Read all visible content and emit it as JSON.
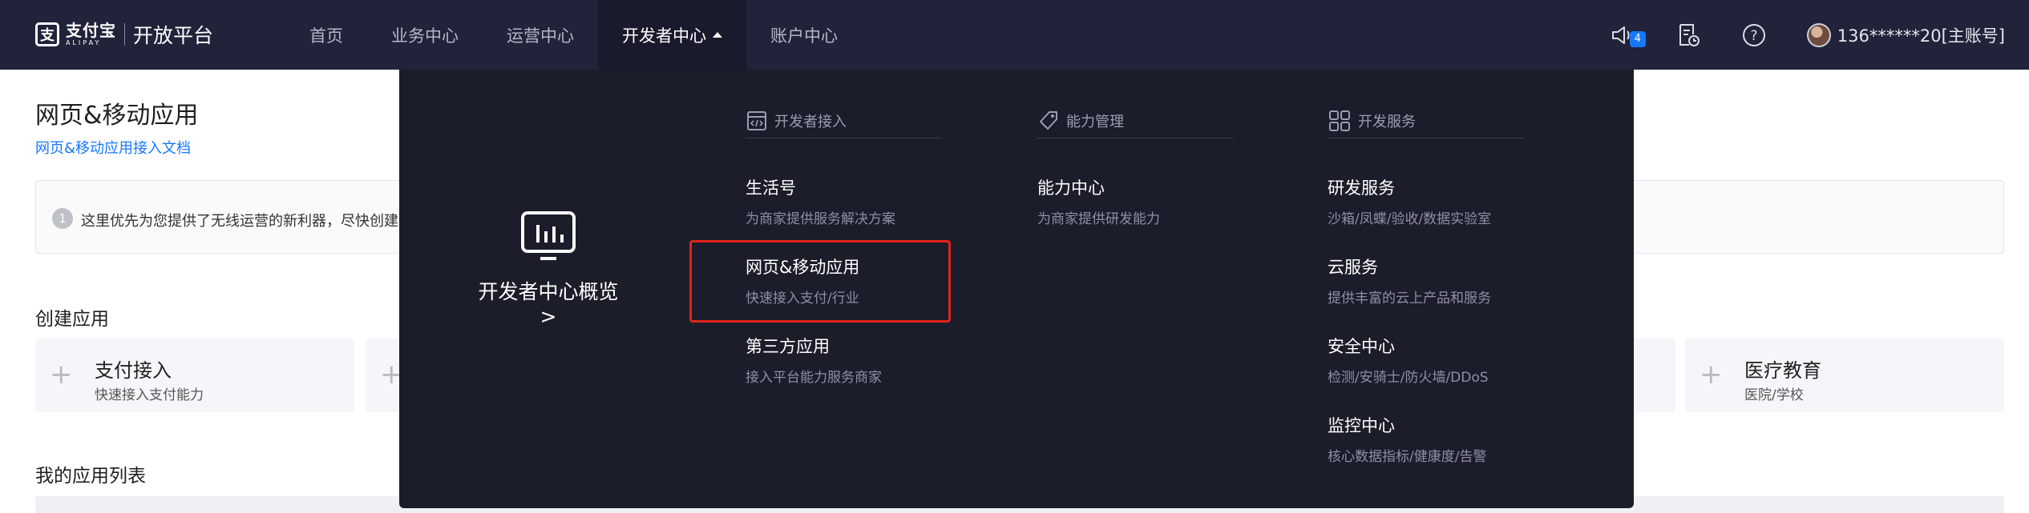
{
  "brand": {
    "logo_cn": "支付宝",
    "logo_en": "ALIPAY",
    "platform": "开放平台"
  },
  "nav": {
    "items": [
      {
        "label": "首页"
      },
      {
        "label": "业务中心"
      },
      {
        "label": "运营中心"
      },
      {
        "label": "开发者中心"
      },
      {
        "label": "账户中心"
      }
    ],
    "active": "开发者中心"
  },
  "top_right": {
    "notification_count": "4",
    "account": "136******20[主账号]"
  },
  "page": {
    "title": "网页&移动应用",
    "doc_link": "网页&移动应用接入文档",
    "notice_icon": "1",
    "notice_text": "这里优先为您提供了无线运营的新利器，尽快创建",
    "create_title": "创建应用",
    "cards": [
      {
        "title": "支付接入",
        "subtitle": "快速接入支付能力"
      },
      {
        "title": "医疗教育",
        "subtitle": "医院/学校"
      }
    ],
    "list_title": "我的应用列表"
  },
  "dropdown": {
    "overview_label": "开发者中心概览 >",
    "columns": [
      {
        "heading": "开发者接入",
        "icon": "code-doc-icon",
        "items": [
          {
            "title": "生活号",
            "subtitle": "为商家提供服务解决方案"
          },
          {
            "title": "网页&移动应用",
            "subtitle": "快速接入支付/行业"
          },
          {
            "title": "第三方应用",
            "subtitle": "接入平台能力服务商家"
          }
        ]
      },
      {
        "heading": "能力管理",
        "icon": "tag-icon",
        "items": [
          {
            "title": "能力中心",
            "subtitle": "为商家提供研发能力"
          }
        ]
      },
      {
        "heading": "开发服务",
        "icon": "grid-icon",
        "items": [
          {
            "title": "研发服务",
            "subtitle": "沙箱/凤蝶/验收/数据实验室"
          },
          {
            "title": "云服务",
            "subtitle": "提供丰富的云上产品和服务"
          },
          {
            "title": "安全中心",
            "subtitle": "检测/安骑士/防火墙/DDoS"
          },
          {
            "title": "监控中心",
            "subtitle": "核心数据指标/健康度/告警"
          }
        ]
      }
    ],
    "highlighted_item": "网页&移动应用",
    "highlight_color": "#e0241c"
  },
  "colors": {
    "topbar": "#21233a",
    "dropdown": "#1c1d2a",
    "link": "#1677ff"
  }
}
